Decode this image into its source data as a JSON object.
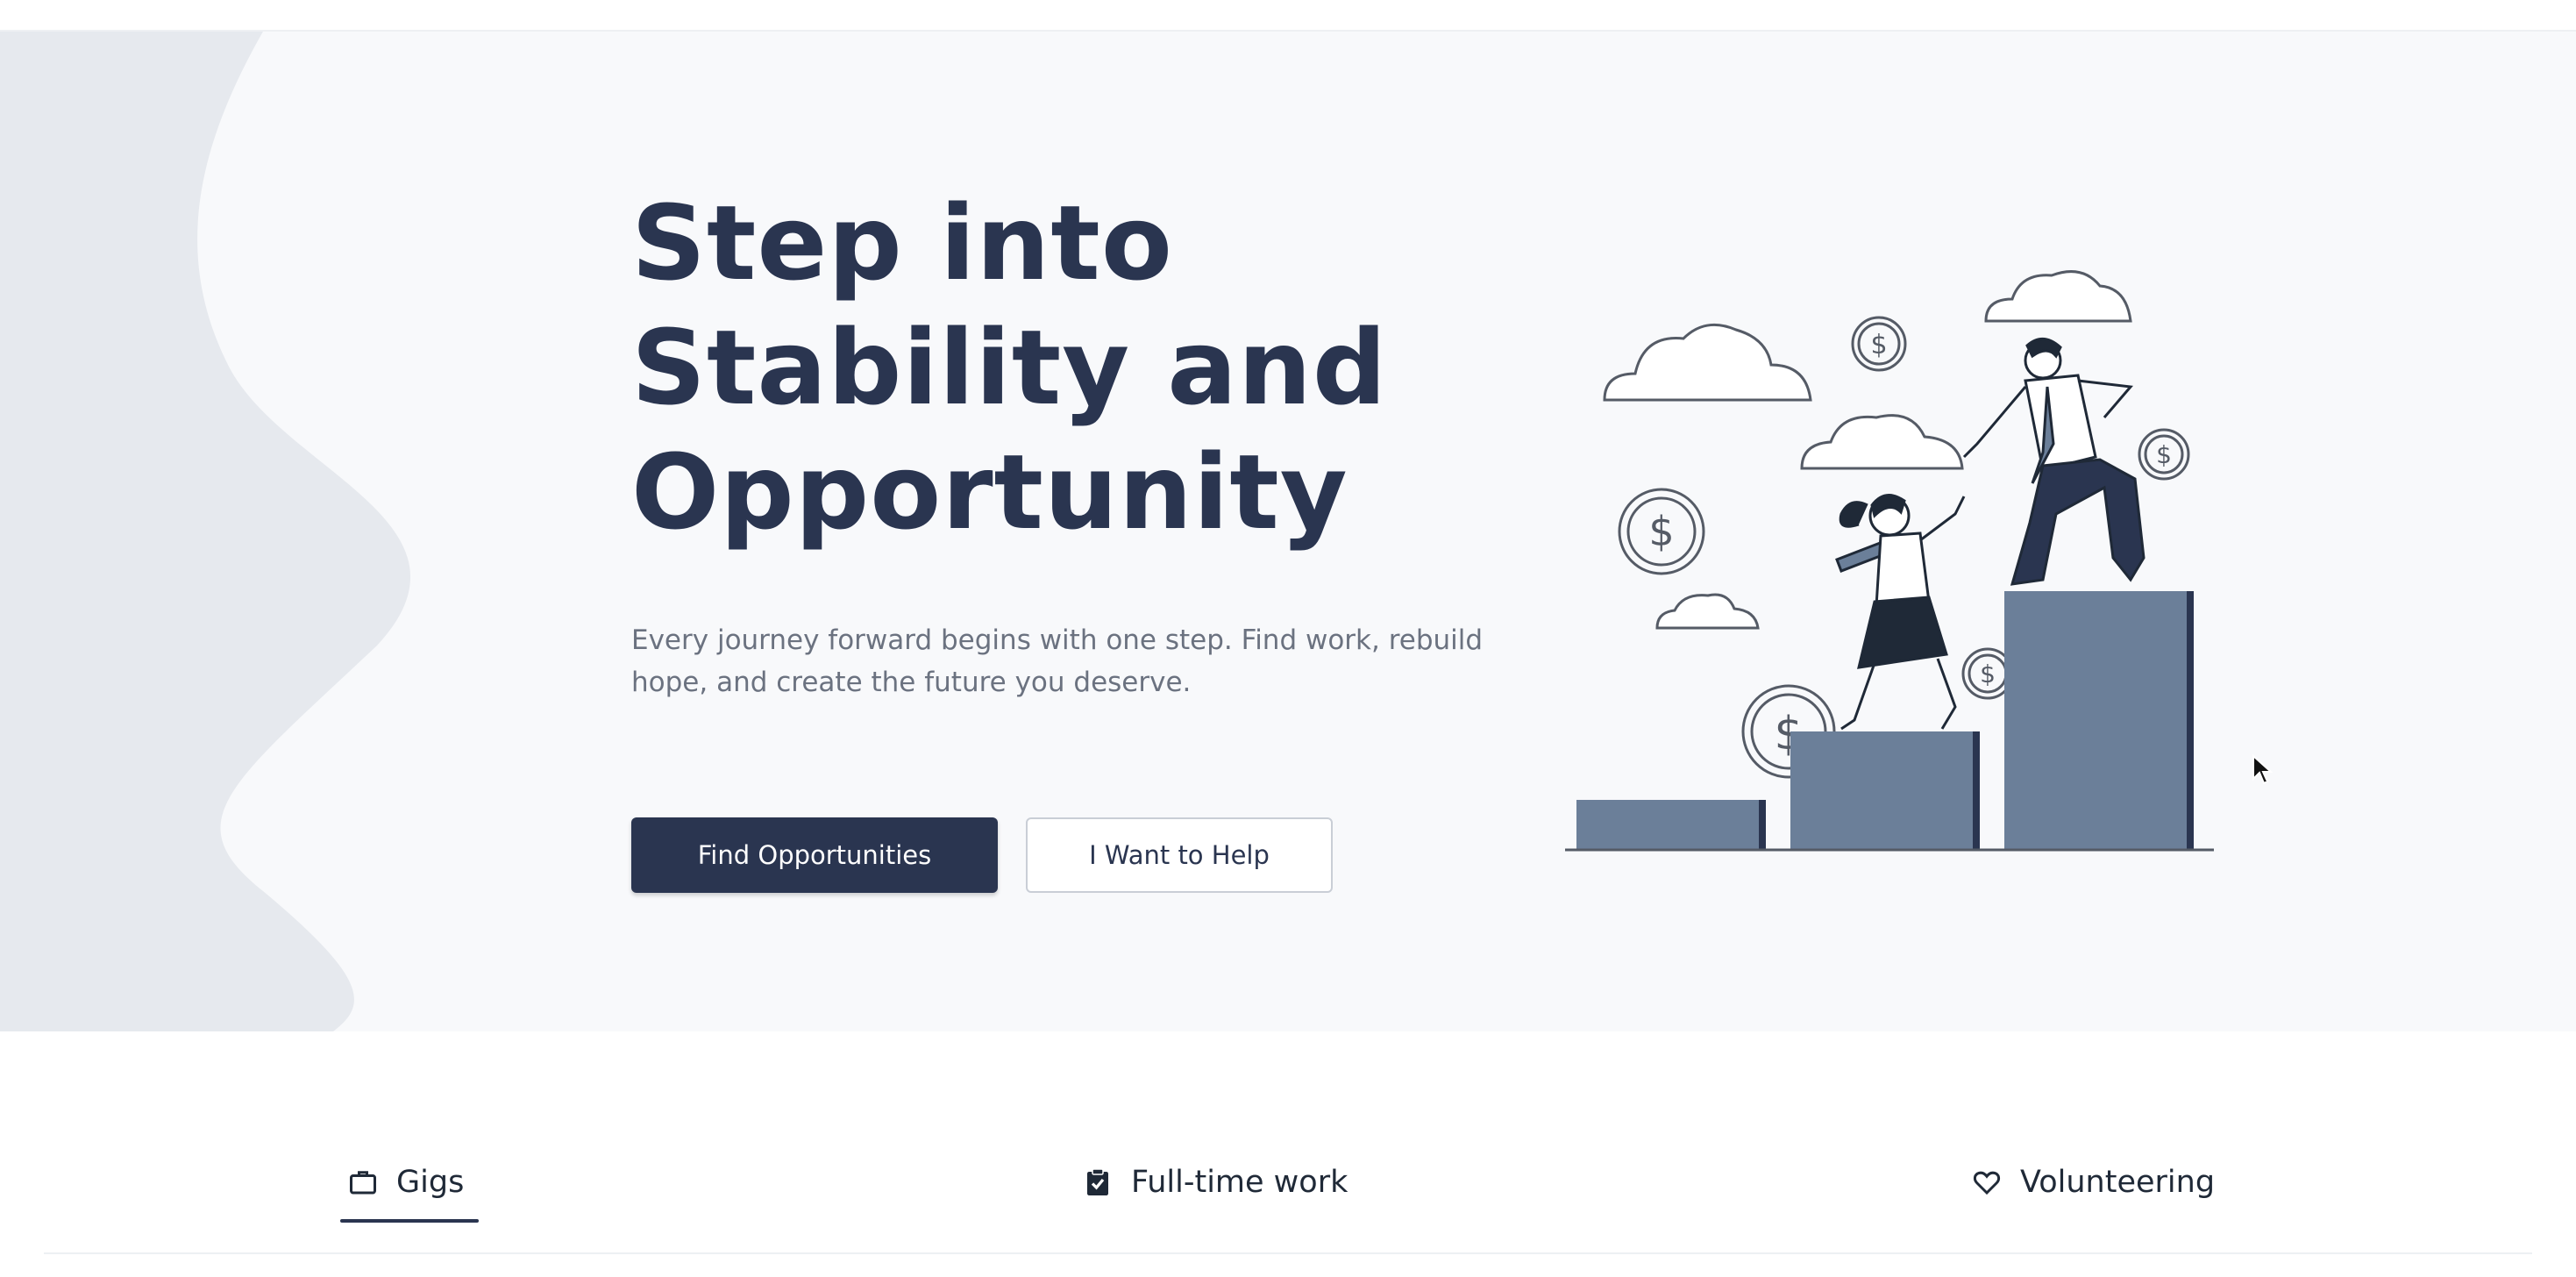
{
  "hero": {
    "title_lines": [
      "Step into",
      "Stability and",
      "Opportunity"
    ],
    "subtitle_lines": [
      "Every journey forward begins with one step. Find work, rebuild",
      "hope, and create the future you deserve."
    ],
    "primary_button": "Find Opportunities",
    "secondary_button": "I Want to Help",
    "illustration": "two-people-climbing-bar-steps-illustration"
  },
  "tabs": [
    {
      "label": "Gigs",
      "icon": "briefcase-icon",
      "active": true
    },
    {
      "label": "Full-time work",
      "icon": "clipboard-check-icon",
      "active": false
    },
    {
      "label": "Volunteering",
      "icon": "heart-icon",
      "active": false
    }
  ],
  "colors": {
    "brand": "#2a3550",
    "hero_bg": "#f8f9fb",
    "wave": "#e6e9ee",
    "bar": "#6b7f99"
  }
}
